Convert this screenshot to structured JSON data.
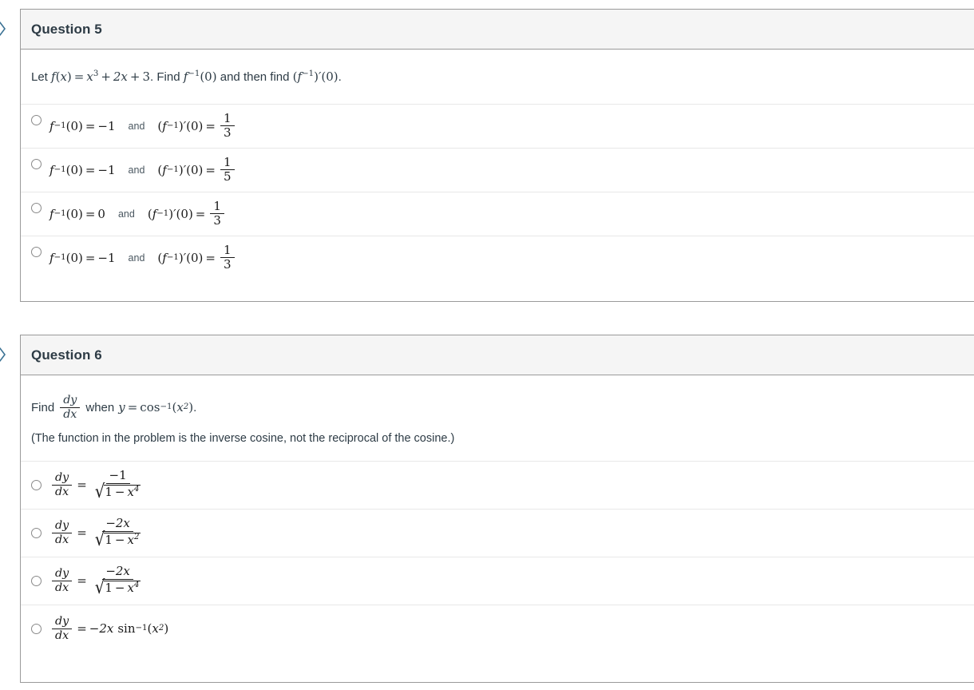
{
  "questions": [
    {
      "id": "q5",
      "header": "Question 5",
      "prompt_plain": "Let f(x) = x^3 + 2x + 3. Find f^-1(0) and then find (f^-1)'(0).",
      "prompt": {
        "lead": "Let ",
        "fn": "f",
        "open": "(",
        "var": "x",
        "close": ")",
        "eq": "=",
        "x": "x",
        "cube": "3",
        "plus1": "+",
        "two_x": "2x",
        "plus2": "+",
        "three": "3",
        "period": ". ",
        "find1": "Find ",
        "finv": "f",
        "inv_exp": "−1",
        "zero_arg": "(0)",
        "mid": " and then find ",
        "tail_open": "(",
        "tail_f": "f",
        "tail_exp": "−1",
        "tail_close": ")",
        "tail_prime": "′",
        "tail_zero": "(0)",
        "tail_period": "."
      },
      "options": [
        {
          "index": 0,
          "plain": "f^-1(0) = -1  and  (f^-1)'(0) = 1/3",
          "lhs_fn": "f",
          "lhs_exp": "−1",
          "lhs_arg": "(0)",
          "lhs_eq": "=",
          "lhs_val": "−1",
          "and": "and",
          "rhs_open": "(",
          "rhs_fn": "f",
          "rhs_exp": "−1",
          "rhs_close": ")",
          "rhs_prime": "′",
          "rhs_arg": "(0)",
          "rhs_eq": "=",
          "frac_num": "1",
          "frac_den": "3"
        },
        {
          "index": 1,
          "plain": "f^-1(0) = -1  and  (f^-1)'(0) = 1/5",
          "lhs_fn": "f",
          "lhs_exp": "−1",
          "lhs_arg": "(0)",
          "lhs_eq": "=",
          "lhs_val": "−1",
          "and": "and",
          "rhs_open": "(",
          "rhs_fn": "f",
          "rhs_exp": "−1",
          "rhs_close": ")",
          "rhs_prime": "′",
          "rhs_arg": "(0)",
          "rhs_eq": "=",
          "frac_num": "1",
          "frac_den": "5"
        },
        {
          "index": 2,
          "plain": "f^-1(0) = 0  and  (f^-1)'(0) = 1/3",
          "lhs_fn": "f",
          "lhs_exp": "−1",
          "lhs_arg": "(0)",
          "lhs_eq": "=",
          "lhs_val": "0",
          "and": "and",
          "rhs_open": "(",
          "rhs_fn": "f",
          "rhs_exp": "−1",
          "rhs_close": ")",
          "rhs_prime": "′",
          "rhs_arg": "(0)",
          "rhs_eq": "=",
          "frac_num": "1",
          "frac_den": "3"
        },
        {
          "index": 3,
          "plain": "f^-1(0) = -1  and  (f^-1)'(0) = 1/3",
          "lhs_fn": "f",
          "lhs_exp": "−1",
          "lhs_arg": "(0)",
          "lhs_eq": "=",
          "lhs_val": "−1",
          "and": "and",
          "rhs_open": "(",
          "rhs_fn": "f",
          "rhs_exp": "−1",
          "rhs_close": ")",
          "rhs_prime": "′",
          "rhs_arg": "(0)",
          "rhs_eq": "=",
          "frac_num": "1",
          "frac_den": "3"
        }
      ]
    },
    {
      "id": "q6",
      "header": "Question 6",
      "prompt_plain": "Find dy/dx when y = cos^-1(x^2).",
      "prompt": {
        "find": "Find",
        "dy_num": "dy",
        "dy_den": "dx",
        "when": "when",
        "y": "y",
        "eq": "=",
        "cos": "cos",
        "cos_exp": "−1",
        "open": "(",
        "x": "x",
        "x_exp": "2",
        "close": ")",
        "period": "."
      },
      "note": "(The function in the problem is the inverse cosine, not the reciprocal of the cosine.)",
      "options": [
        {
          "index": 0,
          "plain": "dy/dx = -1 / sqrt(1 - x^4)",
          "lhs_num": "dy",
          "lhs_den": "dx",
          "eq": "=",
          "rhs_num": "−1",
          "rhs_rad_one": "1",
          "rhs_rad_minus": "−",
          "rhs_rad_x": "x",
          "rhs_rad_exp": "4",
          "form": "fraction"
        },
        {
          "index": 1,
          "plain": "dy/dx = -2x / sqrt(1 - x^2)",
          "lhs_num": "dy",
          "lhs_den": "dx",
          "eq": "=",
          "rhs_num": "−2x",
          "rhs_rad_one": "1",
          "rhs_rad_minus": "−",
          "rhs_rad_x": "x",
          "rhs_rad_exp": "2",
          "form": "fraction"
        },
        {
          "index": 2,
          "plain": "dy/dx = -2x / sqrt(1 - x^4)",
          "lhs_num": "dy",
          "lhs_den": "dx",
          "eq": "=",
          "rhs_num": "−2x",
          "rhs_rad_one": "1",
          "rhs_rad_minus": "−",
          "rhs_rad_x": "x",
          "rhs_rad_exp": "4",
          "form": "fraction"
        },
        {
          "index": 3,
          "plain": "dy/dx = -2x sin^-1(x^2)",
          "lhs_num": "dy",
          "lhs_den": "dx",
          "eq": "=",
          "rhs_coef": "−2x",
          "rhs_fn": "sin",
          "rhs_fn_exp": "−1",
          "rhs_open": "(",
          "rhs_x": "x",
          "rhs_x_exp": "2",
          "rhs_close": ")",
          "form": "inline"
        }
      ]
    }
  ],
  "icons": {
    "collapse_chevron": "chevron-right-hex-icon"
  },
  "colors": {
    "card_border": "#9a9a9a",
    "header_bg": "#f5f5f5",
    "row_divider": "#e8e8e8",
    "text": "#2d3b45",
    "math": "#1a1a1a",
    "chevron": "#3b7294",
    "radio_border": "#8a8a8a"
  }
}
